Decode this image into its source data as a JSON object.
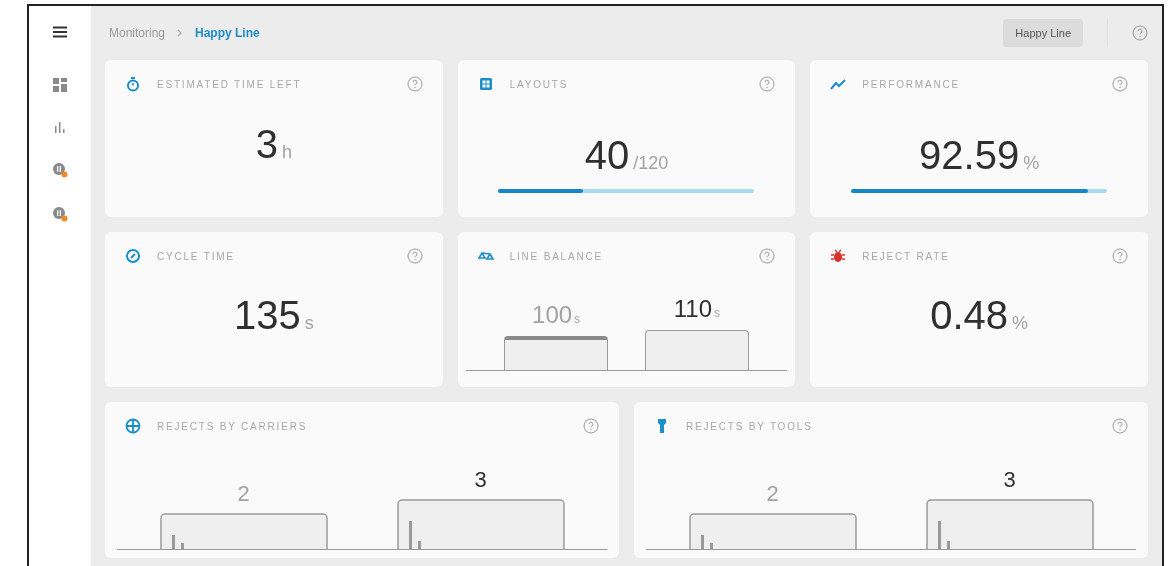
{
  "breadcrumb": [
    {
      "label": "Monitoring",
      "selected": false
    },
    {
      "label": "Happy Line",
      "selected": true
    }
  ],
  "header": {
    "line_badge": "Happy Line"
  },
  "sidebar": {
    "items": [
      {
        "kind": "dashboard"
      },
      {
        "kind": "chart"
      },
      {
        "kind": "station"
      },
      {
        "kind": "station"
      }
    ]
  },
  "cards": [
    {
      "kind": "stat",
      "title": "ESTIMATED TIME LEFT",
      "value": "3",
      "unit": "h"
    },
    {
      "kind": "progress",
      "title": "LAYOUTS",
      "value": "40",
      "unit": "/120",
      "level": 0.33
    },
    {
      "kind": "progress",
      "title": "PERFORMANCE",
      "value": "92.59",
      "unit": "%",
      "level": 0.926
    },
    {
      "kind": "stat",
      "title": "CYCLE TIME",
      "value": "135",
      "unit": "s"
    },
    {
      "kind": "balance",
      "title": "LINE BALANCE",
      "bars": [
        {
          "value": "100",
          "unit": "s",
          "emphasized": false,
          "highlighted": true
        },
        {
          "value": "110",
          "unit": "s",
          "emphasized": true,
          "highlighted": false
        }
      ]
    },
    {
      "kind": "stat",
      "title": "REJECT RATE",
      "value": "0.48",
      "unit": "%"
    }
  ],
  "bottom_cards": [
    {
      "title": "REJECTS BY CARRIERS",
      "bars": [
        {
          "value": "2",
          "emphasized": false
        },
        {
          "value": "3",
          "emphasized": true
        }
      ]
    },
    {
      "title": "REJECTS BY TOOLS",
      "bars": [
        {
          "value": "2",
          "emphasized": false
        },
        {
          "value": "3",
          "emphasized": true
        }
      ]
    }
  ]
}
